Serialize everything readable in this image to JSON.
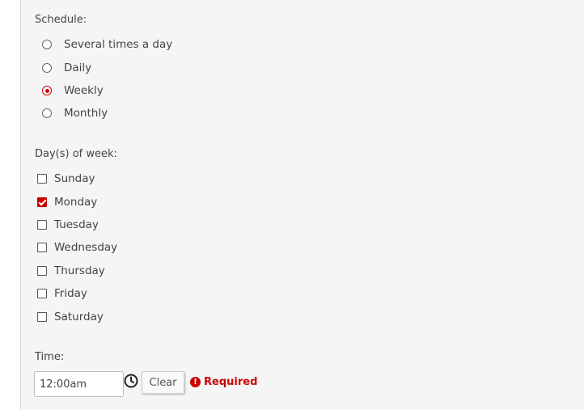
{
  "schedule": {
    "label": "Schedule:",
    "options": [
      {
        "label": "Several times a day",
        "checked": false
      },
      {
        "label": "Daily",
        "checked": false
      },
      {
        "label": "Weekly",
        "checked": true
      },
      {
        "label": "Monthly",
        "checked": false
      }
    ]
  },
  "days": {
    "label": "Day(s) of week:",
    "options": [
      {
        "label": "Sunday",
        "checked": false
      },
      {
        "label": "Monday",
        "checked": true
      },
      {
        "label": "Tuesday",
        "checked": false
      },
      {
        "label": "Wednesday",
        "checked": false
      },
      {
        "label": "Thursday",
        "checked": false
      },
      {
        "label": "Friday",
        "checked": false
      },
      {
        "label": "Saturday",
        "checked": false
      }
    ]
  },
  "time": {
    "label": "Time:",
    "value": "12:00am",
    "clear_label": "Clear",
    "required_text": "Required",
    "icon": "clock-icon",
    "warning_icon": "exclamation-circle-icon"
  },
  "colors": {
    "accent": "#cc0000",
    "panel_bg": "#f5f5f5"
  }
}
